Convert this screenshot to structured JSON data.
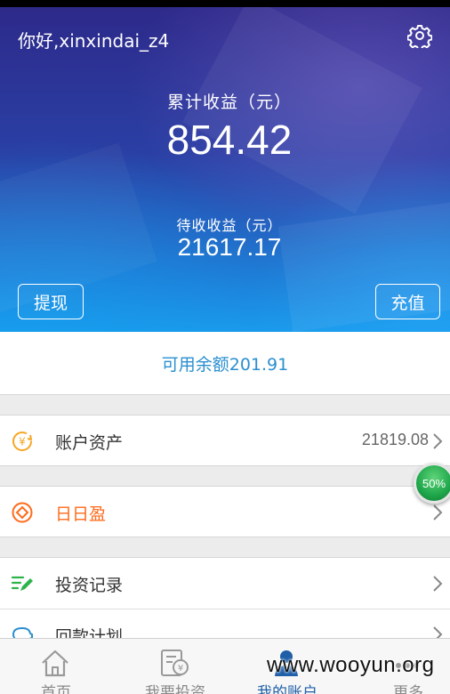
{
  "header": {
    "greeting": "你好,xinxindai_z4",
    "total_earnings_label": "累计收益（元）",
    "total_earnings_value": "854.42",
    "pending_earnings_label": "待收收益（元）",
    "pending_earnings_value": "21617.17",
    "withdraw_label": "提现",
    "recharge_label": "充值"
  },
  "balance": {
    "text": "可用余额201.91"
  },
  "menu": {
    "assets_label": "账户资产",
    "assets_value": "21819.08",
    "daily_label": "日日盈",
    "records_label": "投资记录",
    "plan_label": "回款计划"
  },
  "progress_badge": {
    "text": "50%",
    "value": 50
  },
  "tabs": [
    {
      "label": "首页",
      "icon": "home-icon"
    },
    {
      "label": "我要投资",
      "icon": "invest-icon"
    },
    {
      "label": "我的账户",
      "icon": "account-icon"
    },
    {
      "label": "更多",
      "icon": "more-icon"
    }
  ],
  "watermark": "www.wooyun.org",
  "colors": {
    "accent_blue": "#2a8fd0",
    "daily_orange": "#ff6a1a",
    "active_tab": "#1f5fa8",
    "badge_green": "#1ea64a"
  }
}
